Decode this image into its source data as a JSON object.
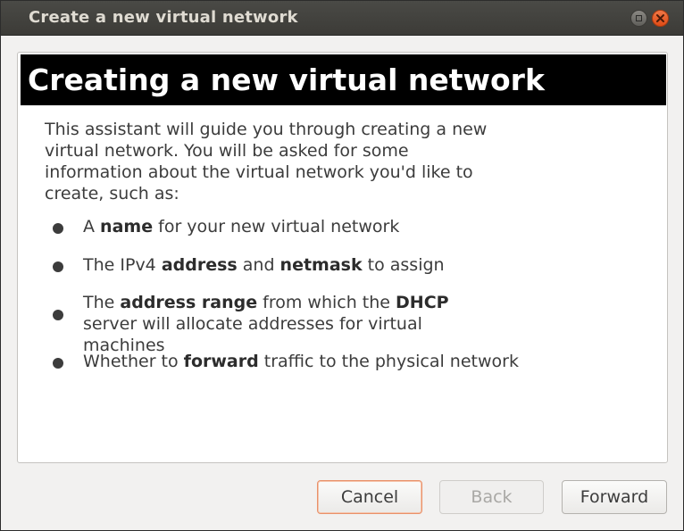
{
  "window": {
    "title": "Create a new virtual network"
  },
  "banner": {
    "title": "Creating a new virtual network"
  },
  "intro_text": "This assistant will guide you through creating a new virtual network. You will be asked for some information about the virtual network you'd like to create, such as:",
  "bullets": [
    {
      "parts": [
        "A ",
        "name",
        " for your new virtual network"
      ]
    },
    {
      "parts": [
        "The IPv4 ",
        "address",
        " and ",
        "netmask",
        " to assign"
      ]
    },
    {
      "parts": [
        "The ",
        "address range",
        " from which the ",
        "DHCP",
        " server will allocate addresses for virtual machines"
      ]
    },
    {
      "parts": [
        "Whether to ",
        "forward",
        " traffic to the physical network"
      ]
    }
  ],
  "buttons": {
    "cancel": "Cancel",
    "back": "Back",
    "forward": "Forward"
  },
  "colors": {
    "titlebar": "#3c3b37",
    "close_button": "#df4b16",
    "banner_background": "#000000",
    "focus_ring": "#e9916a"
  }
}
